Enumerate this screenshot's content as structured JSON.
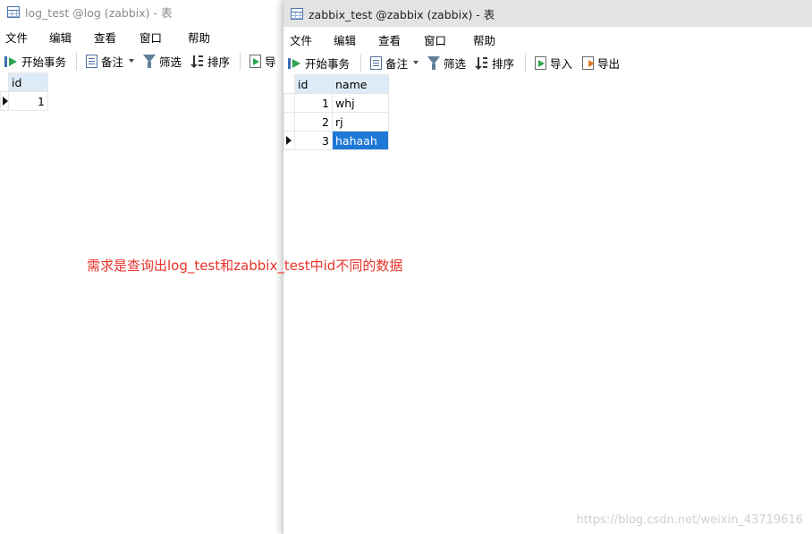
{
  "left_window": {
    "title": "log_test @log (zabbix) - 表",
    "menu": [
      "文件",
      "编辑",
      "查看",
      "窗口",
      "帮助"
    ],
    "toolbar": {
      "begin": "开始事务",
      "memo": "备注",
      "filter": "筛选",
      "sort": "排序",
      "import_partial": "导"
    },
    "columns": [
      "id"
    ],
    "rows": [
      {
        "id": "1"
      }
    ]
  },
  "right_window": {
    "title": "zabbix_test @zabbix (zabbix) - 表",
    "menu": [
      "文件",
      "编辑",
      "查看",
      "窗口",
      "帮助"
    ],
    "toolbar": {
      "begin": "开始事务",
      "memo": "备注",
      "filter": "筛选",
      "sort": "排序",
      "import": "导入",
      "export": "导出"
    },
    "columns": [
      "id",
      "name"
    ],
    "rows": [
      {
        "id": "1",
        "name": "whj"
      },
      {
        "id": "2",
        "name": "rj"
      },
      {
        "id": "3",
        "name": "hahaah"
      }
    ]
  },
  "annotation": "需求是查询出log_test和zabbix_test中id不同的数据",
  "watermark": "https://blog.csdn.net/weixin_43719616",
  "colors": {
    "annotation": "#e8322b",
    "selected_cell": "#1e78d7",
    "header_bg": "#dcebf7"
  },
  "icons": [
    "table-icon",
    "begin-transaction-icon",
    "memo-icon",
    "filter-icon",
    "sort-icon",
    "import-icon",
    "export-icon",
    "row-pointer-icon"
  ]
}
